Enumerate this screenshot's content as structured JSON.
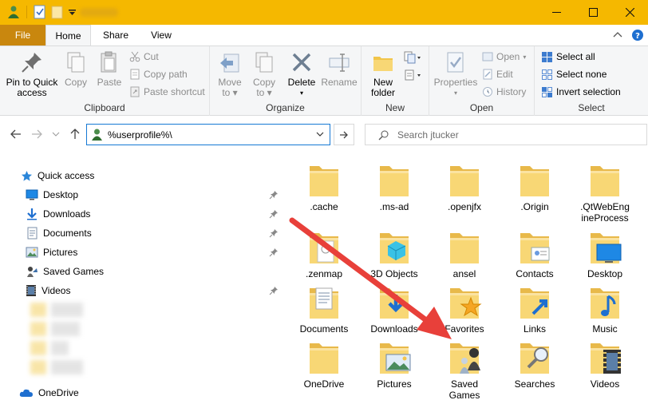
{
  "tabs": {
    "file": "File",
    "home": "Home",
    "share": "Share",
    "view": "View"
  },
  "ribbon": {
    "clipboard": {
      "label": "Clipboard",
      "pin_line1": "Pin to Quick",
      "pin_line2": "access",
      "copy": "Copy",
      "paste": "Paste",
      "cut": "Cut",
      "copy_path": "Copy path",
      "paste_shortcut": "Paste shortcut"
    },
    "organize": {
      "label": "Organize",
      "move_line1": "Move",
      "move_line2": "to",
      "copy_line1": "Copy",
      "copy_line2": "to",
      "delete": "Delete",
      "rename": "Rename"
    },
    "new": {
      "label": "New",
      "folder_line1": "New",
      "folder_line2": "folder"
    },
    "open": {
      "label": "Open",
      "properties": "Properties",
      "open": "Open",
      "edit": "Edit",
      "history": "History"
    },
    "select": {
      "label": "Select",
      "select_all": "Select all",
      "select_none": "Select none",
      "invert": "Invert selection"
    }
  },
  "address": {
    "value": "%userprofile%\\",
    "search_placeholder": "Search jtucker"
  },
  "nav": {
    "quick_access": "Quick access",
    "items": [
      "Desktop",
      "Downloads",
      "Documents",
      "Pictures",
      "Saved Games",
      "Videos"
    ],
    "onedrive": "OneDrive"
  },
  "folders": [
    {
      "name": ".cache"
    },
    {
      "name": ".ms-ad"
    },
    {
      "name": ".openjfx"
    },
    {
      "name": ".Origin"
    },
    {
      "name": ".QtWebEng",
      "name2": "ineProcess"
    },
    {
      "name": ".zenmap"
    },
    {
      "name": "3D Objects"
    },
    {
      "name": "ansel"
    },
    {
      "name": "Contacts"
    },
    {
      "name": "Desktop"
    },
    {
      "name": "Documents"
    },
    {
      "name": "Downloads"
    },
    {
      "name": "Favorites"
    },
    {
      "name": "Links"
    },
    {
      "name": "Music"
    },
    {
      "name": "OneDrive"
    },
    {
      "name": "Pictures"
    },
    {
      "name": "Saved",
      "name2": "Games"
    },
    {
      "name": "Searches"
    },
    {
      "name": "Videos"
    }
  ],
  "colors": {
    "titlebar": "#f5b800",
    "file_tab": "#c9870e",
    "accent": "#1679d4",
    "folder": "#f8d775",
    "arrow": "#e8403a"
  }
}
